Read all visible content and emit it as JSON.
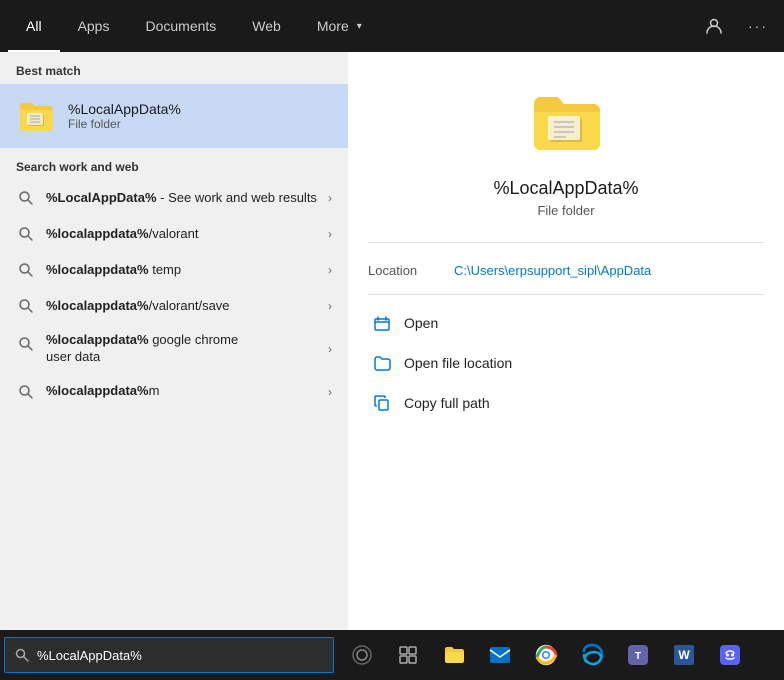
{
  "nav": {
    "tabs": [
      {
        "id": "all",
        "label": "All",
        "active": true
      },
      {
        "id": "apps",
        "label": "Apps",
        "active": false
      },
      {
        "id": "documents",
        "label": "Documents",
        "active": false
      },
      {
        "id": "web",
        "label": "Web",
        "active": false
      }
    ],
    "more_label": "More",
    "icons": {
      "person": "👤",
      "ellipsis": "···"
    }
  },
  "left": {
    "best_match_label": "Best match",
    "best_match": {
      "title": "%LocalAppData%",
      "subtitle": "File folder"
    },
    "search_work_label": "Search work and web",
    "results": [
      {
        "id": "r1",
        "text_bold": "%LocalAppData%",
        "text_rest": " - See work and web results",
        "has_chevron": true,
        "multiline": true
      },
      {
        "id": "r2",
        "text_bold": "%localappdata%",
        "text_rest": "/valorant",
        "has_chevron": true,
        "multiline": false
      },
      {
        "id": "r3",
        "text_bold": "%localappdata%",
        "text_rest": " temp",
        "has_chevron": true,
        "multiline": false
      },
      {
        "id": "r4",
        "text_bold": "%localappdata%",
        "text_rest": "/valorant/save",
        "has_chevron": true,
        "multiline": false
      },
      {
        "id": "r5",
        "text_bold": "%localappdata%",
        "text_rest": " google chrome user data",
        "has_chevron": true,
        "multiline": true
      },
      {
        "id": "r6",
        "text_bold": "%localappdata%",
        "text_rest": "m",
        "has_chevron": true,
        "multiline": false
      }
    ]
  },
  "right": {
    "app_title": "%LocalAppData%",
    "app_type": "File folder",
    "location_label": "Location",
    "location_path": "C:\\Users\\erpsupport_sipl\\AppData",
    "actions": [
      {
        "id": "open",
        "label": "Open"
      },
      {
        "id": "open_file_location",
        "label": "Open file location"
      },
      {
        "id": "copy_full_path",
        "label": "Copy full path"
      }
    ]
  },
  "taskbar": {
    "search_value": "%LocalAppData%",
    "search_placeholder": "%LocalAppData%",
    "apps": [
      {
        "id": "search",
        "icon": "⊙",
        "name": "Search"
      },
      {
        "id": "task-view",
        "icon": "▣",
        "name": "Task View"
      },
      {
        "id": "file-explorer",
        "icon": "📁",
        "name": "File Explorer"
      },
      {
        "id": "outlook",
        "icon": "📧",
        "name": "Outlook"
      },
      {
        "id": "chrome",
        "icon": "🌐",
        "name": "Chrome"
      },
      {
        "id": "edge",
        "icon": "🌊",
        "name": "Edge"
      },
      {
        "id": "teams",
        "icon": "👥",
        "name": "Teams"
      },
      {
        "id": "word",
        "icon": "W",
        "name": "Word"
      },
      {
        "id": "discord",
        "icon": "💬",
        "name": "Discord"
      }
    ]
  }
}
